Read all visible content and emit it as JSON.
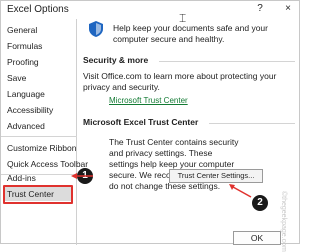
{
  "window": {
    "title": "Excel Options",
    "help_icon": "?",
    "close_icon": "×"
  },
  "sidebar": {
    "items": [
      {
        "label": "General"
      },
      {
        "label": "Formulas"
      },
      {
        "label": "Proofing"
      },
      {
        "label": "Save"
      },
      {
        "label": "Language"
      },
      {
        "label": "Accessibility"
      },
      {
        "label": "Advanced"
      },
      {
        "label": "Customize Ribbon"
      },
      {
        "label": "Quick Access Toolbar"
      },
      {
        "label": "Add-ins"
      },
      {
        "label": "Trust Center"
      }
    ],
    "selected": "Trust Center"
  },
  "content": {
    "intro": "Help keep your documents safe and your computer secure and healthy.",
    "security": {
      "heading": "Security & more",
      "text": "Visit Office.com to learn more about protecting your privacy and security.",
      "link": "Microsoft Trust Center"
    },
    "trust_center": {
      "heading": "Microsoft Excel Trust Center",
      "text": "The Trust Center contains security and privacy settings. These settings help keep your computer secure. We recommend that you do not change these settings.",
      "button": "Trust Center Settings..."
    }
  },
  "footer": {
    "ok": "OK"
  },
  "annotations": {
    "badge1": "1",
    "badge2": "2"
  },
  "watermark": "©thegeekpage.com",
  "colors": {
    "highlight": "#e0322e",
    "link": "#127a33",
    "shield": "#1f66c1"
  },
  "icons": [
    "shield-icon",
    "cursor-icon"
  ]
}
